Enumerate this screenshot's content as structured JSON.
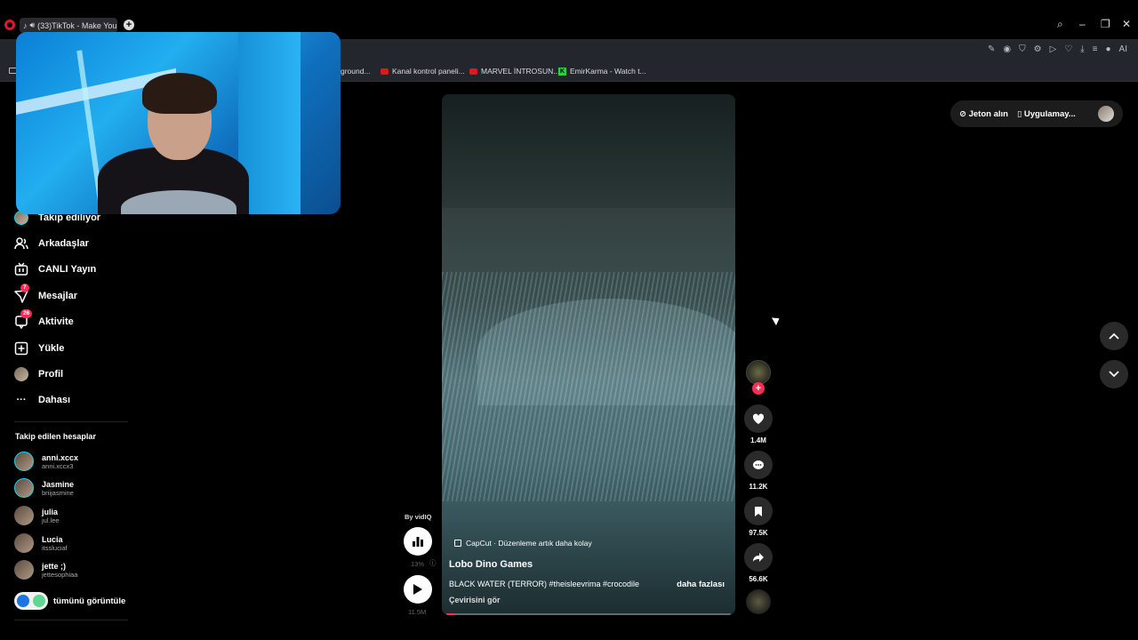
{
  "browser": {
    "tab_title": "(33)TikTok - Make You",
    "bookmarks": [
      {
        "label": "ground..."
      },
      {
        "label": "Kanal kontrol paneli..."
      },
      {
        "label": "MARVEL İNTROSUN..."
      },
      {
        "label": "EmirKarma - Watch t..."
      }
    ],
    "ai_label": "AI"
  },
  "sidebar": {
    "items": [
      {
        "label": "Takip ediliyor"
      },
      {
        "label": "Arkadaşlar"
      },
      {
        "label": "CANLI Yayın"
      },
      {
        "label": "Mesajlar",
        "badge": "7"
      },
      {
        "label": "Aktivite",
        "badge": "26"
      },
      {
        "label": "Yükle"
      },
      {
        "label": "Profil"
      },
      {
        "label": "Dahası"
      }
    ],
    "following_title": "Takip edilen hesaplar",
    "accounts": [
      {
        "name": "anni.xccx",
        "handle": "anni.xccx3"
      },
      {
        "name": "Jasmine",
        "handle": "briijasmine"
      },
      {
        "name": "julia",
        "handle": "jul.lee"
      },
      {
        "name": "Lucia",
        "handle": "itssluciaf"
      },
      {
        "name": "jette ;)",
        "handle": "jettesophiaa"
      }
    ],
    "see_all": "tümünü görüntüle"
  },
  "topbar": {
    "coins": "Jeton alın",
    "app": "Uygulamay..."
  },
  "video": {
    "capcut": "CapCut · Düzenleme artık daha kolay",
    "author": "Lobo Dino Games",
    "description": "BLACK WATER (TERROR) #theisleevrima #crocodile",
    "more": "daha fazlası",
    "translate": "Çevirisini gör",
    "progress_fraction": 0.03
  },
  "actions": {
    "likes": "1.4M",
    "comments": "11.2K",
    "saves": "97.5K",
    "shares": "56.6K"
  },
  "vidiq": {
    "by": "By vidIQ",
    "pct": "13%",
    "views": "11.5M"
  },
  "colors": {
    "accent": "#fe2c55",
    "ring": "#20d5ec"
  }
}
